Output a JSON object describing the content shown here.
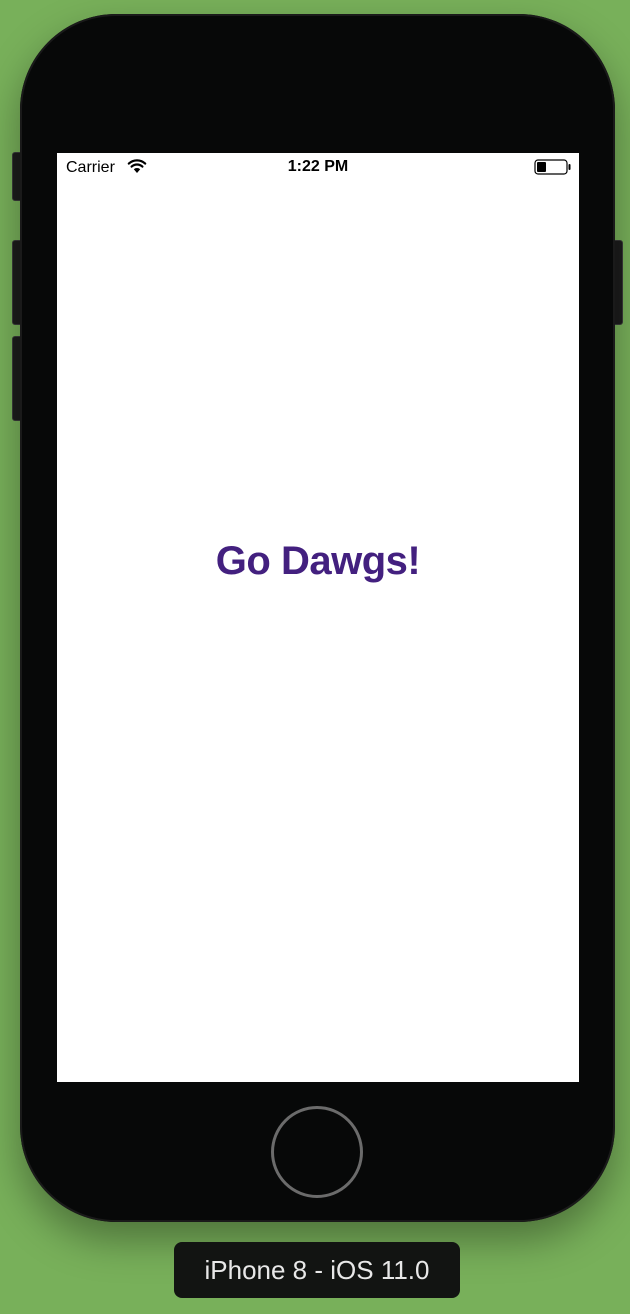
{
  "simulator": {
    "device_label": "iPhone 8 - iOS 11.0"
  },
  "status_bar": {
    "carrier": "Carrier",
    "time": "1:22 PM",
    "wifi_icon": "wifi-icon",
    "battery_icon": "battery-icon"
  },
  "app": {
    "headline": "Go Dawgs!"
  },
  "colors": {
    "background": "#78b05a",
    "device": "#070808",
    "headline": "#43207f"
  }
}
